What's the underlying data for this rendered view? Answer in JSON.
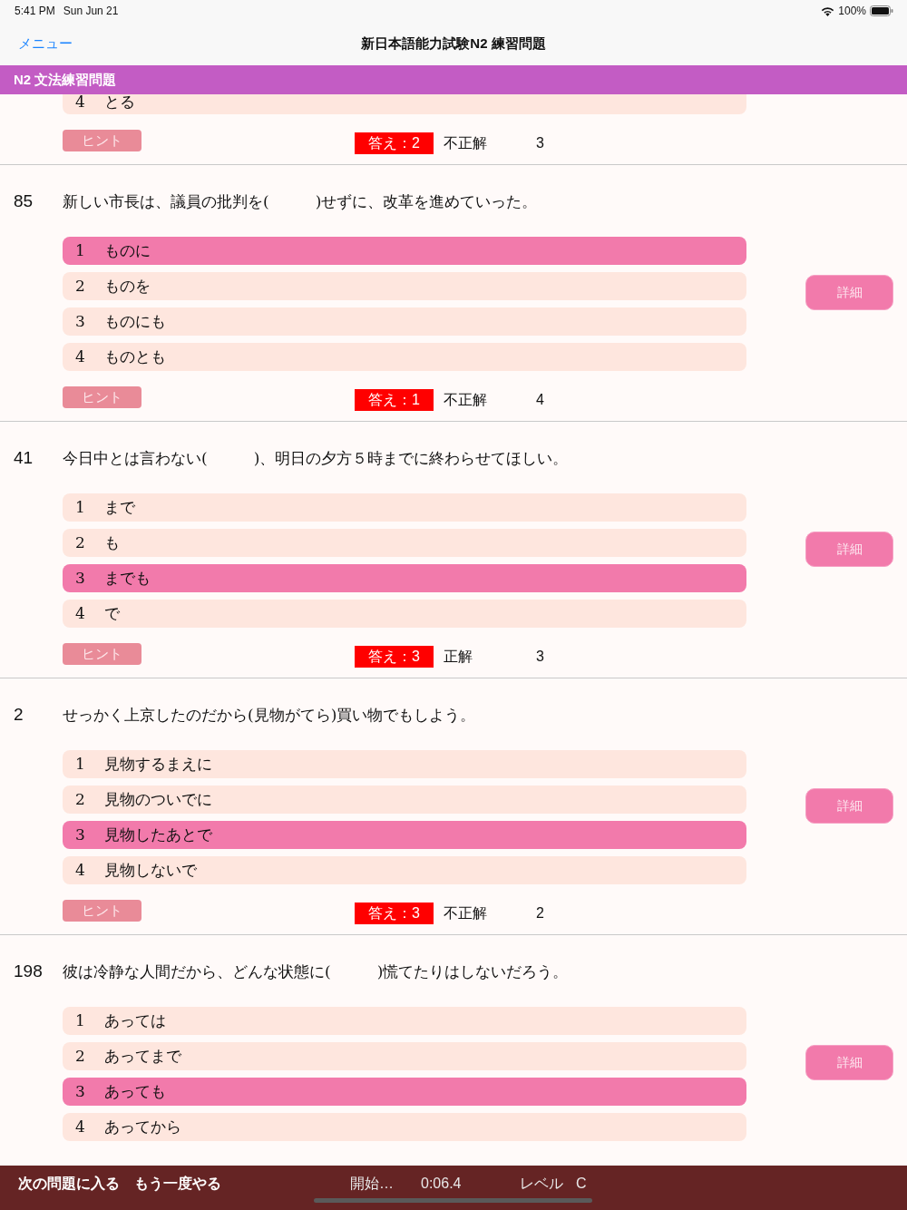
{
  "status_bar": {
    "time": "5:41 PM",
    "date": "Sun Jun 21",
    "battery": "100%"
  },
  "nav_bar": {
    "back_link": "メニュー",
    "title": "新日本語能力試験N2 練習問題"
  },
  "banner": {
    "title": "N2 文法練習問題"
  },
  "questions": [
    {
      "options": [
        {
          "number": "4",
          "text": "とる",
          "selected": false
        }
      ],
      "hint_button": "ヒント",
      "answer": "答え：2",
      "result": "不正解",
      "count": "3"
    },
    {
      "number": "85",
      "text": "新しい市長は、議員の批判を(　　　)せずに、改革を進めていった。",
      "options": [
        {
          "number": "1",
          "text": "ものに",
          "selected": true
        },
        {
          "number": "2",
          "text": "ものを",
          "selected": false
        },
        {
          "number": "3",
          "text": "ものにも",
          "selected": false
        },
        {
          "number": "4",
          "text": "ものとも",
          "selected": false
        }
      ],
      "detail_button": "詳細",
      "hint_button": "ヒント",
      "answer": "答え：1",
      "result": "不正解",
      "count": "4"
    },
    {
      "number": "41",
      "text": "今日中とは言わない(　　　)、明日の夕方５時までに終わらせてほしい。",
      "options": [
        {
          "number": "1",
          "text": "まで",
          "selected": false
        },
        {
          "number": "2",
          "text": "も",
          "selected": false
        },
        {
          "number": "3",
          "text": "までも",
          "selected": true
        },
        {
          "number": "4",
          "text": "で",
          "selected": false
        }
      ],
      "detail_button": "詳細",
      "hint_button": "ヒント",
      "answer": "答え：3",
      "result": "正解",
      "count": "3"
    },
    {
      "number": "2",
      "text": "せっかく上京したのだから(見物がてら)買い物でもしよう。",
      "options": [
        {
          "number": "1",
          "text": "見物するまえに",
          "selected": false
        },
        {
          "number": "2",
          "text": "見物のついでに",
          "selected": false
        },
        {
          "number": "3",
          "text": "見物したあとで",
          "selected": true
        },
        {
          "number": "4",
          "text": "見物しないで",
          "selected": false
        }
      ],
      "detail_button": "詳細",
      "hint_button": "ヒント",
      "answer": "答え：3",
      "result": "不正解",
      "count": "2"
    },
    {
      "number": "198",
      "text": "彼は冷静な人間だから、どんな状態に(　　　)慌てたりはしないだろう。",
      "options": [
        {
          "number": "1",
          "text": "あっては",
          "selected": false
        },
        {
          "number": "2",
          "text": "あってまで",
          "selected": false
        },
        {
          "number": "3",
          "text": "あっても",
          "selected": true
        },
        {
          "number": "4",
          "text": "あってから",
          "selected": false
        }
      ],
      "detail_button": "詳細"
    }
  ],
  "bottom_bar": {
    "next_button": "次の問題に入る",
    "retry_button": "もう一度やる",
    "status": "開始…",
    "timer": "0:06.4",
    "level_label": "レベル",
    "level_value": "C"
  }
}
